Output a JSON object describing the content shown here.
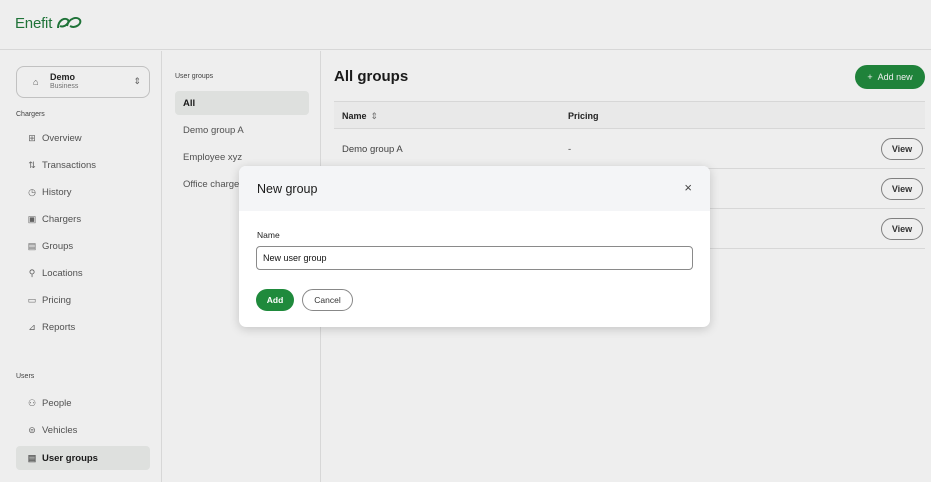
{
  "brand": {
    "name": "Enefit",
    "logo_icon": "leaf-loop-icon",
    "color": "#1f7a3a"
  },
  "org_switcher": {
    "name": "Demo",
    "subtitle": "Business",
    "icon": "building-icon",
    "chevron": "⌃⌄"
  },
  "sidebar": {
    "chargers_title": "Chargers",
    "chargers_items": [
      {
        "label": "Overview",
        "icon": "grid-icon",
        "glyph": "⊞"
      },
      {
        "label": "Transactions",
        "icon": "transactions-icon",
        "glyph": "⇅"
      },
      {
        "label": "History",
        "icon": "history-icon",
        "glyph": "◷"
      },
      {
        "label": "Chargers",
        "icon": "charger-icon",
        "glyph": "▣"
      },
      {
        "label": "Groups",
        "icon": "groups-icon",
        "glyph": "▤"
      },
      {
        "label": "Locations",
        "icon": "location-icon",
        "glyph": "⚲"
      },
      {
        "label": "Pricing",
        "icon": "pricing-icon",
        "glyph": "▭"
      },
      {
        "label": "Reports",
        "icon": "reports-icon",
        "glyph": "⊿"
      }
    ],
    "users_title": "Users",
    "users_items": [
      {
        "label": "People",
        "icon": "people-icon",
        "glyph": "⚇"
      },
      {
        "label": "Vehicles",
        "icon": "vehicle-icon",
        "glyph": "⊜"
      },
      {
        "label": "User groups",
        "icon": "user-groups-icon",
        "glyph": "▤"
      }
    ]
  },
  "groups_panel": {
    "title": "User groups",
    "items": [
      "All",
      "Demo group A",
      "Employee xyz",
      "Office chargers"
    ]
  },
  "main": {
    "title": "All groups",
    "add_new": "Add new",
    "add_new_glyph": "+",
    "columns": {
      "name": "Name",
      "sort_glyph": "⇕",
      "pricing": "Pricing"
    },
    "rows": [
      {
        "name": "Demo group A",
        "pricing": "-",
        "action": "View"
      },
      {
        "name": "",
        "pricing": "",
        "action": "View"
      },
      {
        "name": "",
        "pricing": "",
        "action": "View"
      }
    ]
  },
  "modal": {
    "title": "New group",
    "close_glyph": "×",
    "field_label": "Name",
    "input_value": "New user group",
    "add_label": "Add",
    "cancel_label": "Cancel"
  },
  "colors": {
    "accent": "#1f8a3c",
    "active_nav": "#eef0ee",
    "modal_header": "#f4f5f7"
  }
}
